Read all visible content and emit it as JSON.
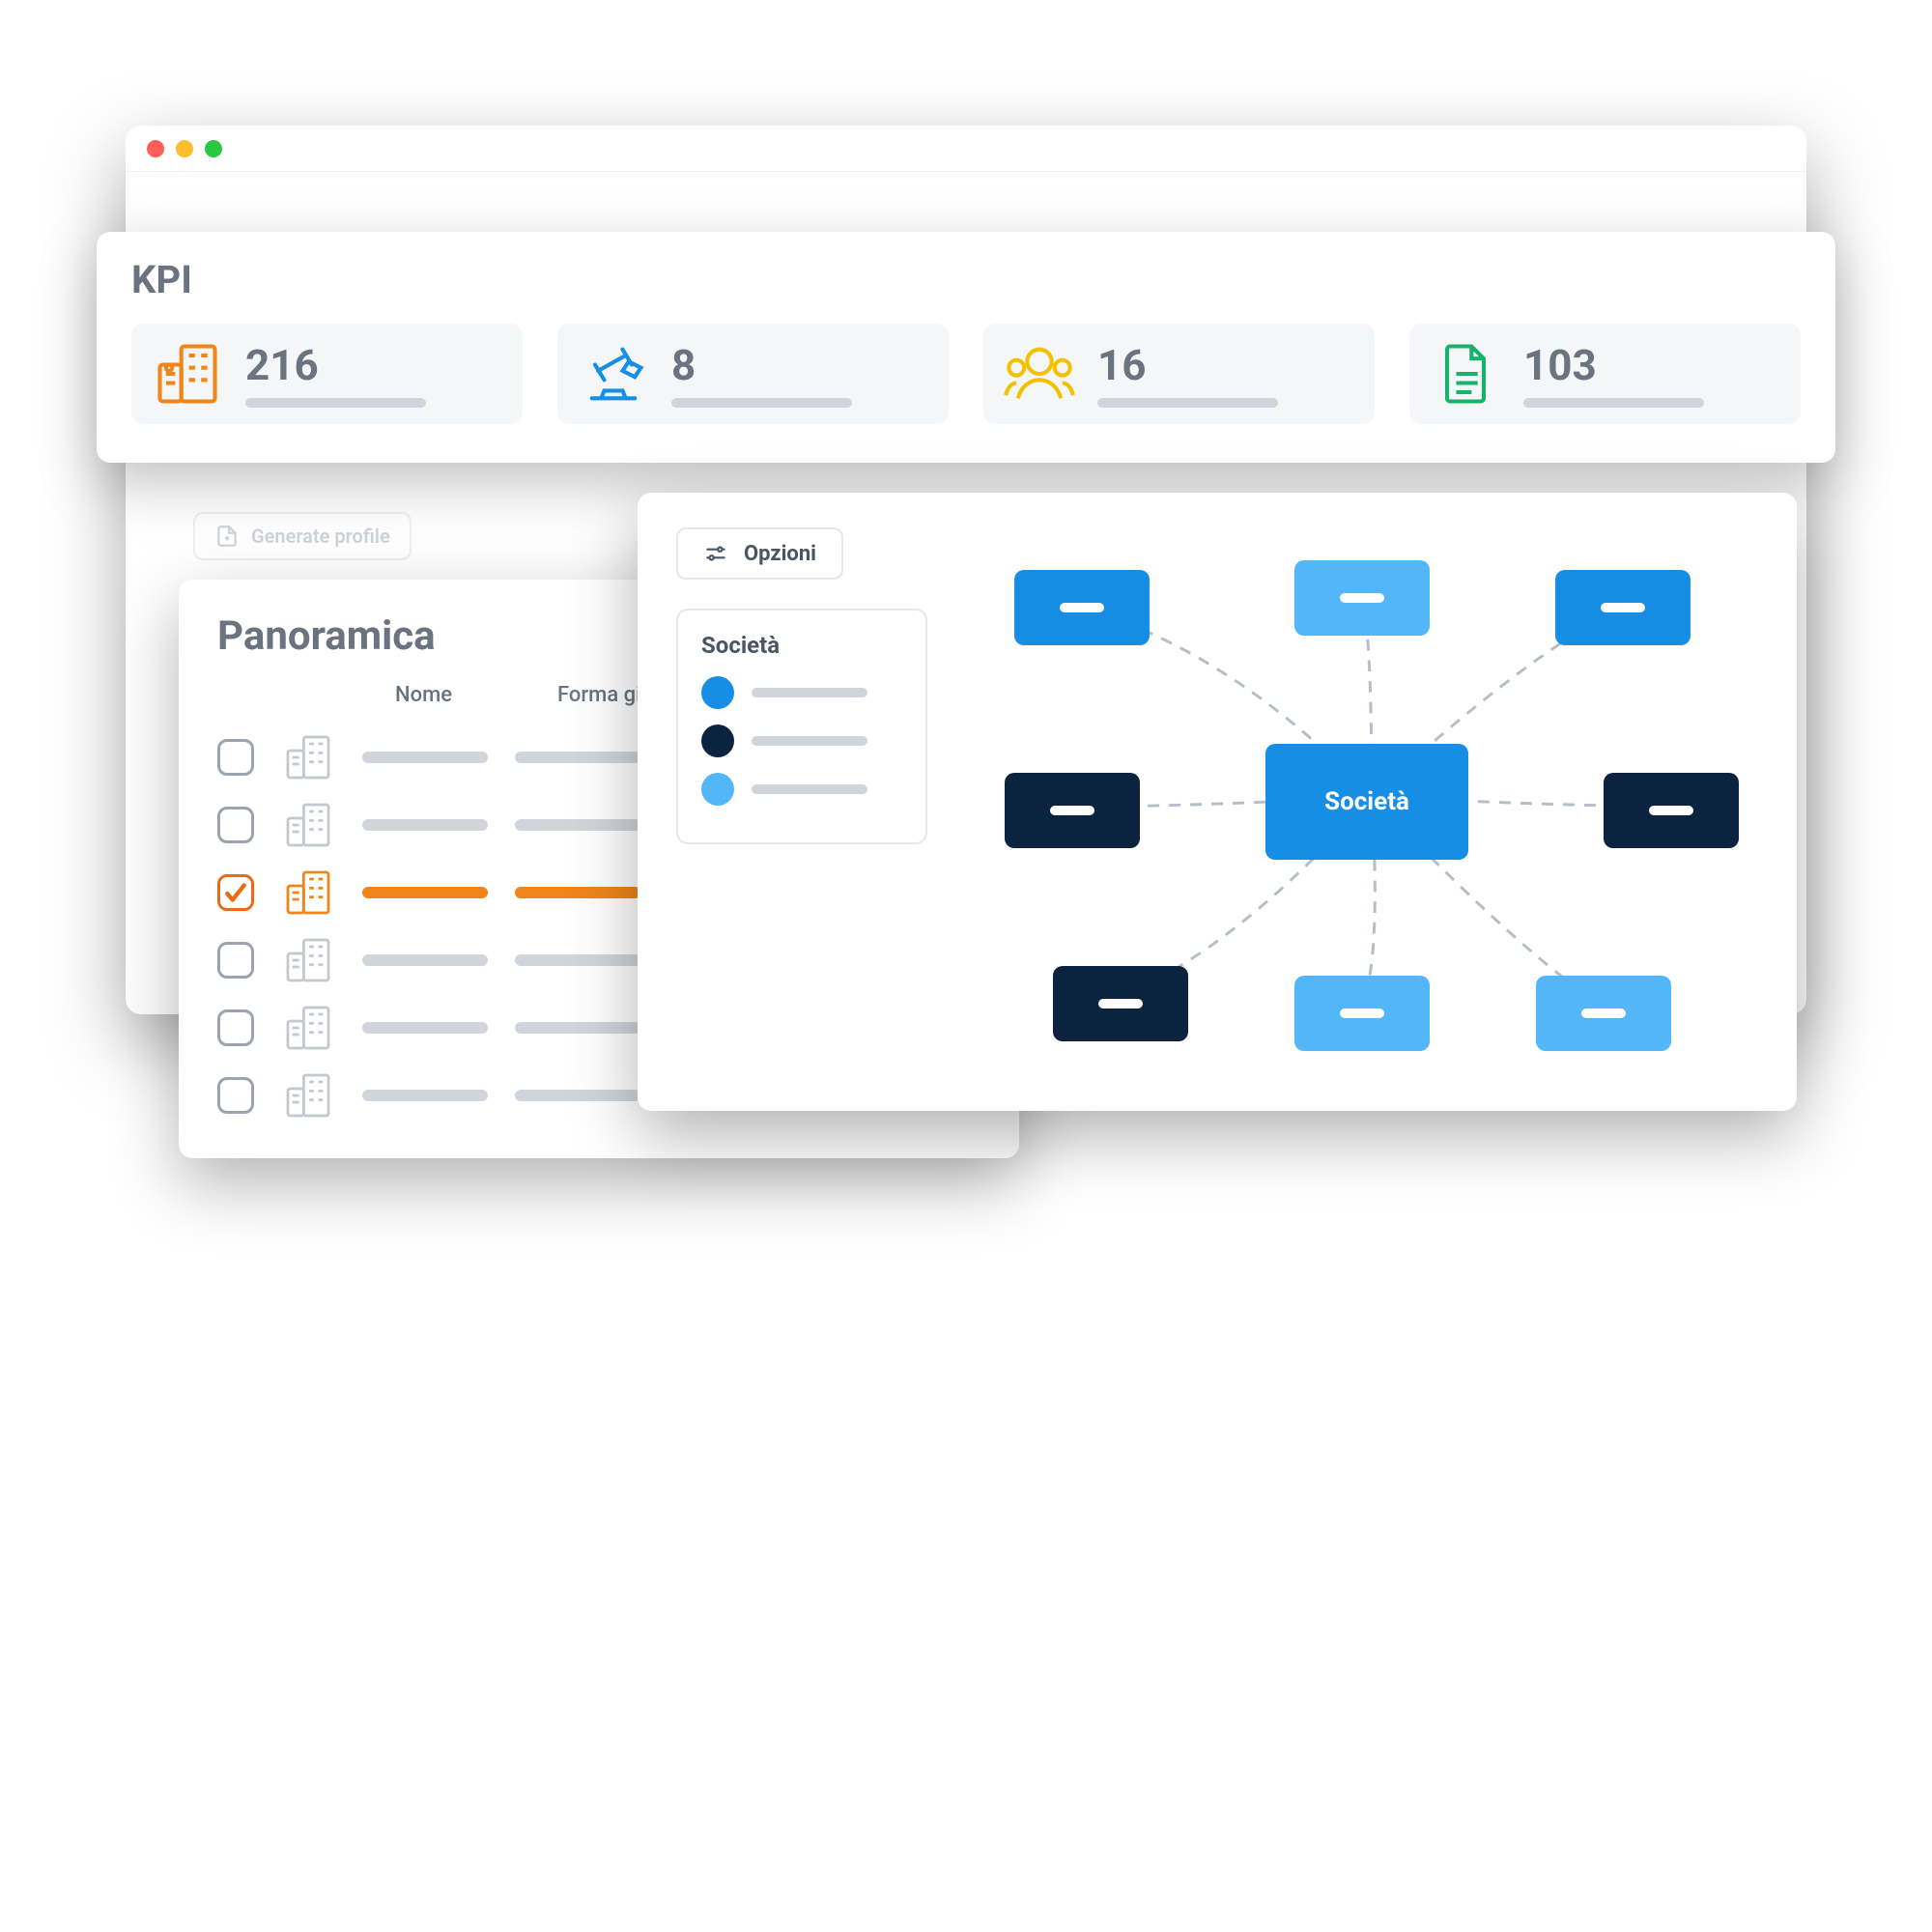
{
  "kpi": {
    "title": "KPI",
    "items": [
      {
        "icon": "building",
        "value": "216",
        "color": "#f08519"
      },
      {
        "icon": "gavel",
        "value": "8",
        "color": "#168ee6"
      },
      {
        "icon": "people",
        "value": "16",
        "color": "#f2c200"
      },
      {
        "icon": "document",
        "value": "103",
        "color": "#17b36a"
      }
    ]
  },
  "generate": {
    "label": "Generate profile"
  },
  "panoramica": {
    "title": "Panoramica",
    "columns": {
      "nome": "Nome",
      "forma": "Forma giuridica"
    },
    "rows": [
      {
        "checked": false
      },
      {
        "checked": false
      },
      {
        "checked": true
      },
      {
        "checked": false
      },
      {
        "checked": false
      },
      {
        "checked": false
      }
    ]
  },
  "diagram": {
    "options_label": "Opzioni",
    "legend_title": "Società",
    "legend": [
      {
        "color": "#168ee6"
      },
      {
        "color": "#0c2340"
      },
      {
        "color": "#53b6f9"
      }
    ],
    "center_label": "Società"
  },
  "colors": {
    "orange": "#f08519",
    "blue": "#168ee6",
    "lightblue": "#53b6f9",
    "navy": "#0c2340",
    "yellow": "#f2c200",
    "green": "#17b36a"
  }
}
